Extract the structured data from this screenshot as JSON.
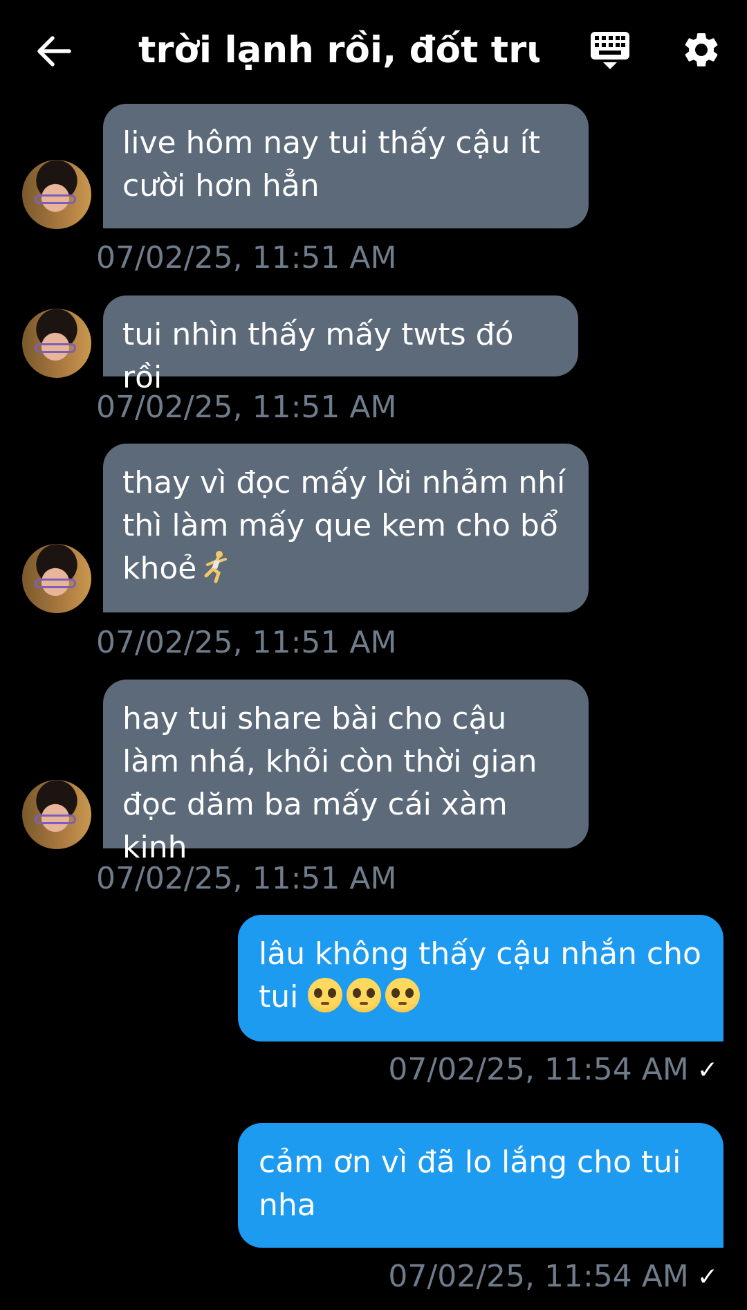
{
  "header": {
    "title": "trời lạnh rồi, đốt trư..."
  },
  "icons": {
    "back": "arrow-left-icon",
    "keyboard": "keyboard-icon",
    "settings": "gear-icon",
    "read_receipt": "checkmark-icon",
    "pleading_emoji": "pleading-face-emoji",
    "runner_emoji": "person-running-emoji"
  },
  "colors": {
    "background": "#000000",
    "incoming_bubble": "#5d6a7a",
    "outgoing_bubble": "#1d9bf0",
    "timestamp": "#6f7c8b"
  },
  "messages": [
    {
      "direction": "incoming",
      "text": "live hôm nay tui thấy cậu ít cười hơn hẳn",
      "timestamp": "07/02/25, 11:51 AM"
    },
    {
      "direction": "incoming",
      "text": "tui nhìn thấy mấy twts đó rồi",
      "timestamp": "07/02/25, 11:51 AM"
    },
    {
      "direction": "incoming",
      "text": "thay vì đọc mấy lời nhảm nhí thì làm mấy que kem cho bổ khoẻ",
      "timestamp": "07/02/25, 11:51 AM"
    },
    {
      "direction": "incoming",
      "text": "hay tui share bài cho cậu làm nhá, khỏi còn thời gian đọc dăm ba mấy cái xàm kinh",
      "timestamp": "07/02/25, 11:51 AM"
    },
    {
      "direction": "outgoing",
      "text": "lâu không thấy cậu nhắn cho tui",
      "timestamp": "07/02/25, 11:54 AM"
    },
    {
      "direction": "outgoing",
      "text": "cảm ơn vì đã lo lắng cho tui nha",
      "timestamp": "07/02/25, 11:54 AM"
    }
  ]
}
